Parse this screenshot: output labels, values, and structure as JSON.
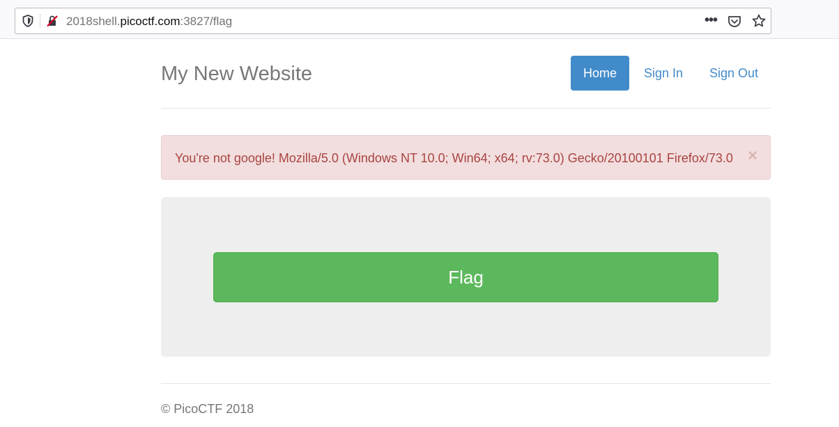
{
  "browser": {
    "url_prefix": "2018shell.",
    "url_domain": "picoctf.com",
    "url_suffix": ":3827/flag",
    "more_label": "•••",
    "icons": {
      "tracking": "shield-icon",
      "insecure": "insecure-lock-icon",
      "more": "more-actions-icon",
      "pocket": "pocket-icon",
      "bookmark": "bookmark-star-icon"
    }
  },
  "header": {
    "site_title": "My New Website",
    "nav": {
      "home": "Home",
      "sign_in": "Sign In",
      "sign_out": "Sign Out"
    }
  },
  "alert": {
    "message": "You're not google! Mozilla/5.0 (Windows NT 10.0; Win64; x64; rv:73.0) Gecko/20100101 Firefox/73.0",
    "close_label": "×"
  },
  "main": {
    "flag_button": "Flag"
  },
  "footer": {
    "text": "© PicoCTF 2018"
  },
  "colors": {
    "primary": "#428bca",
    "success": "#5cb85c",
    "danger_text": "#a94442",
    "danger_bg": "#f2dede"
  }
}
